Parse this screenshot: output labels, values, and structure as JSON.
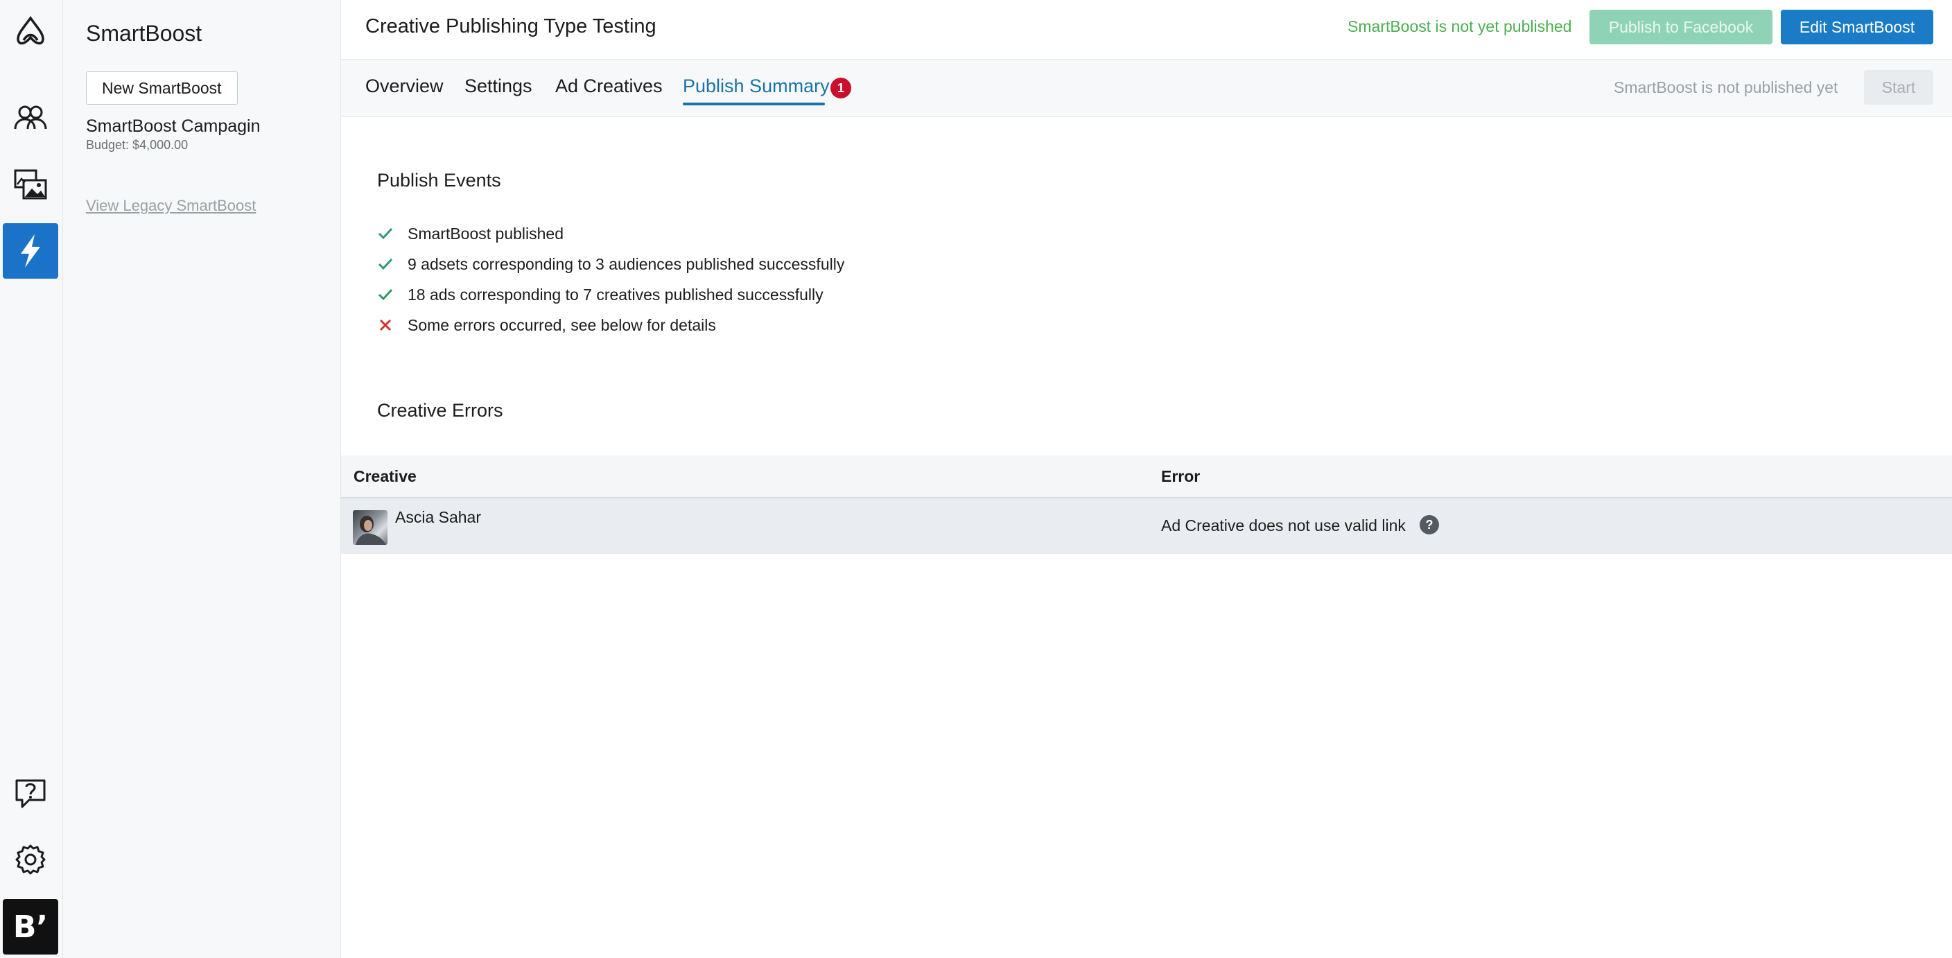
{
  "sidebar": {
    "title": "SmartBoost",
    "new_button": "New SmartBoost",
    "campaign": {
      "name": "SmartBoost Campagin",
      "budget": "Budget: $4,000.00"
    },
    "legacy_link": "View Legacy SmartBoost"
  },
  "rail": {
    "icons": [
      "app-logo-icon",
      "audiences-icon",
      "creatives-icon",
      "smartboost-bolt-icon",
      "help-icon",
      "settings-icon"
    ],
    "brand": "B’",
    "accent": "#1a73c9"
  },
  "header": {
    "title": "Creative Publishing Type Testing",
    "status": "SmartBoost is not yet published",
    "publish_button": "Publish to Facebook",
    "edit_button": "Edit SmartBoost"
  },
  "tabs": {
    "items": [
      {
        "label": "Overview"
      },
      {
        "label": "Settings"
      },
      {
        "label": "Ad Creatives"
      },
      {
        "label": "Publish Summary",
        "active": true,
        "badge": "1"
      }
    ],
    "status": "SmartBoost is not published yet",
    "start_button": "Start"
  },
  "publish_events": {
    "title": "Publish Events",
    "items": [
      {
        "status": "success",
        "text": "SmartBoost published"
      },
      {
        "status": "success",
        "text": "9 adsets corresponding to 3 audiences published successfully"
      },
      {
        "status": "success",
        "text": "18 ads corresponding to 7 creatives published successfully"
      },
      {
        "status": "error",
        "text": "Some errors occurred, see below for details"
      }
    ]
  },
  "creative_errors": {
    "title": "Creative Errors",
    "columns": [
      "Creative",
      "Error"
    ],
    "rows": [
      {
        "creative": "Ascia Sahar",
        "error": "Ad Creative does not use valid link"
      }
    ]
  },
  "colors": {
    "success": "#2e9a6a",
    "error": "#d93025",
    "primary": "#1a7bc6",
    "published_status": "#4caf50"
  }
}
